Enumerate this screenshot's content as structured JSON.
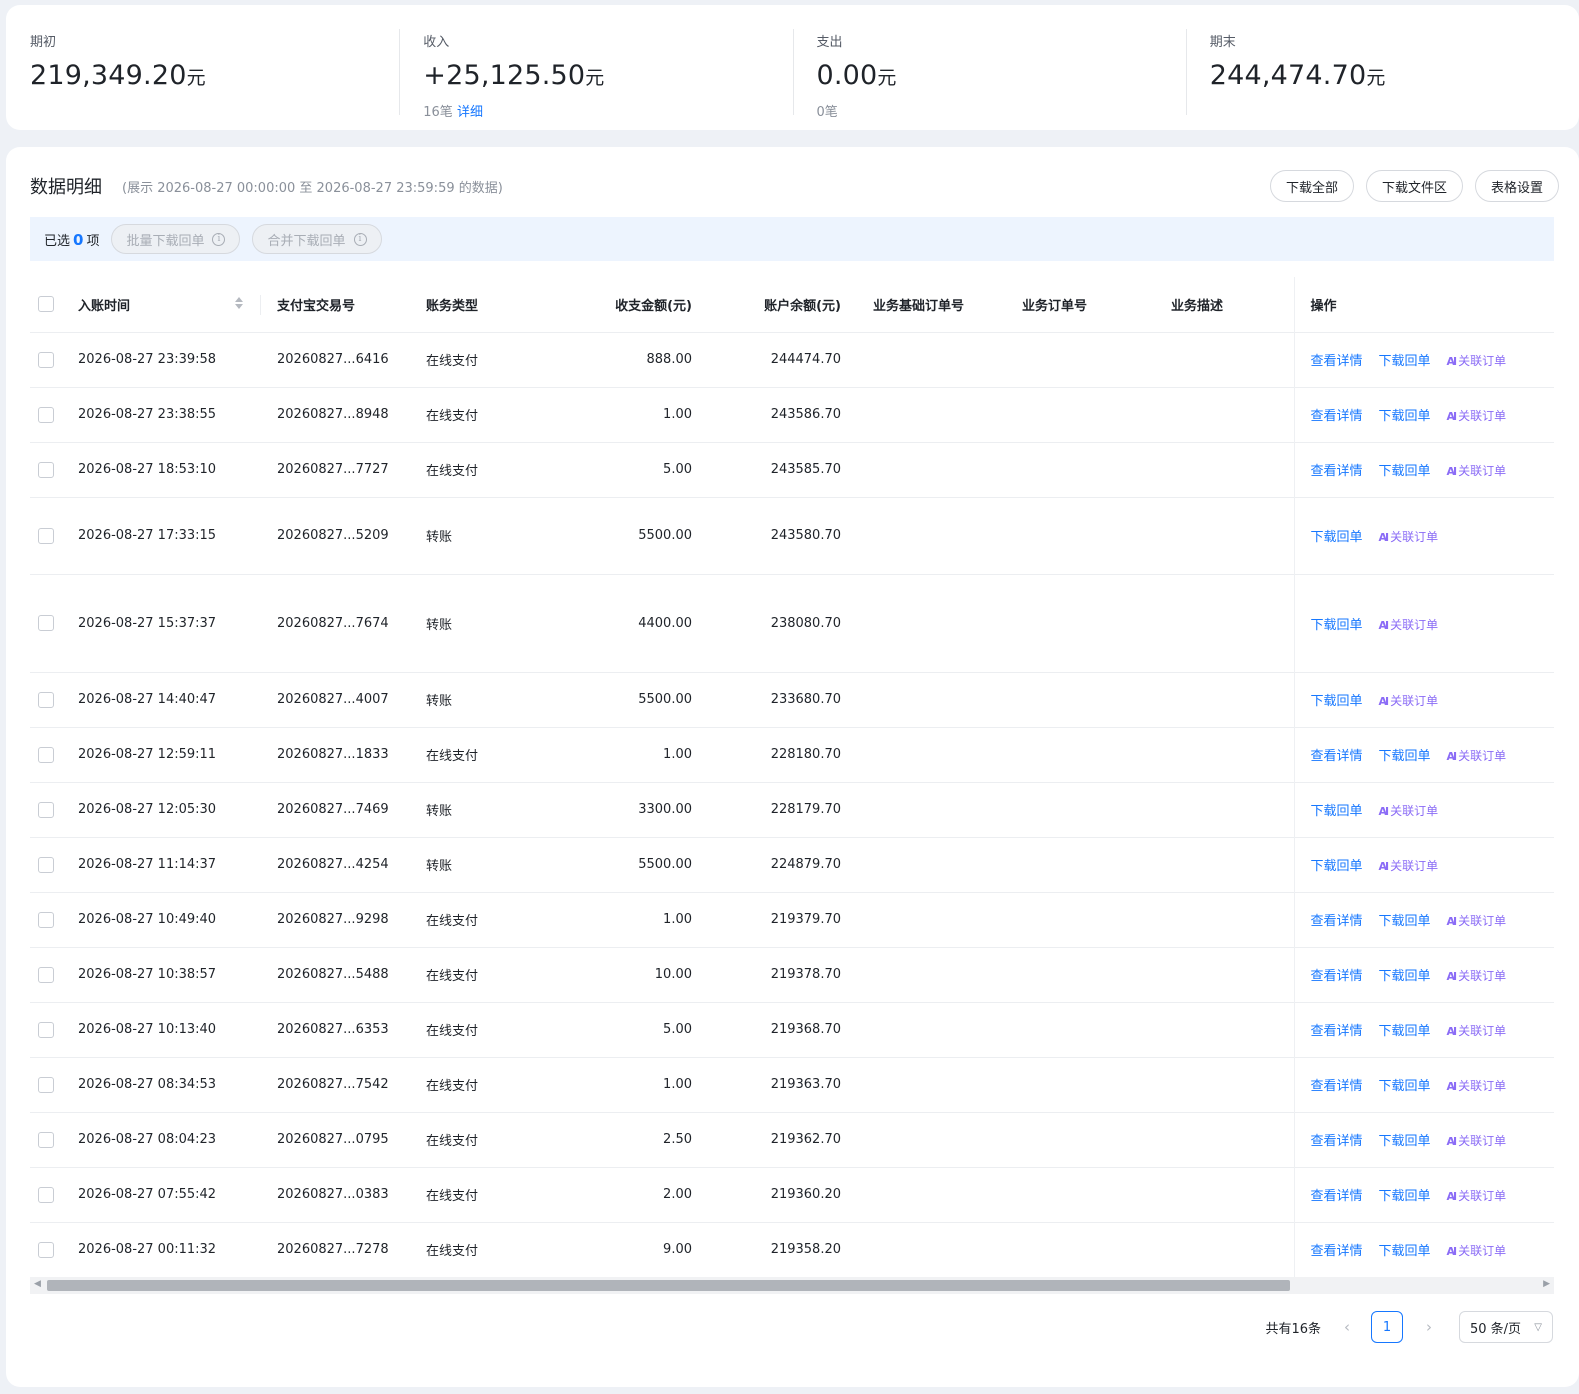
{
  "summary": [
    {
      "label": "期初",
      "value": "219,349.20",
      "unit": "元",
      "sub": "",
      "detail": ""
    },
    {
      "label": "收入",
      "value": "+25,125.50",
      "unit": "元",
      "sub": "16笔",
      "detail": "详细"
    },
    {
      "label": "支出",
      "value": "0.00",
      "unit": "元",
      "sub": "0笔",
      "detail": ""
    },
    {
      "label": "期末",
      "value": "244,474.70",
      "unit": "元",
      "sub": "",
      "detail": ""
    }
  ],
  "section": {
    "title": "数据明细",
    "note": "(展示 2026-08-27 00:00:00 至 2026-08-27 23:59:59 的数据)",
    "buttons": {
      "download_all": "下载全部",
      "download_area": "下载文件区",
      "table_settings": "表格设置"
    }
  },
  "selection": {
    "prefix": "已选",
    "count": "0",
    "suffix": "项",
    "batch_download": "批量下载回单",
    "merge_download": "合并下载回单",
    "info_glyph": "i"
  },
  "table": {
    "columns": {
      "time": "入账时间",
      "trade_no": "支付宝交易号",
      "type": "账务类型",
      "amount": "收支金额(元)",
      "balance": "账户余额(元)",
      "base_order": "业务基础订单号",
      "order": "业务订单号",
      "desc": "业务描述",
      "ops": "操作"
    },
    "actions": {
      "detail": "查看详情",
      "receipt": "下载回单",
      "link_order": "关联订单",
      "ai_glyph": "AI"
    },
    "rows": [
      {
        "time": "2026-08-27 23:39:58",
        "trade_no": "20260827...6416",
        "type": "在线支付",
        "amount": "888.00",
        "balance": "244474.70",
        "has_detail": true
      },
      {
        "time": "2026-08-27 23:38:55",
        "trade_no": "20260827...8948",
        "type": "在线支付",
        "amount": "1.00",
        "balance": "243586.70",
        "has_detail": true
      },
      {
        "time": "2026-08-27 18:53:10",
        "trade_no": "20260827...7727",
        "type": "在线支付",
        "amount": "5.00",
        "balance": "243585.70",
        "has_detail": true
      },
      {
        "time": "2026-08-27 17:33:15",
        "trade_no": "20260827...5209",
        "type": "转账",
        "amount": "5500.00",
        "balance": "243580.70",
        "has_detail": false
      },
      {
        "time": "2026-08-27 15:37:37",
        "trade_no": "20260827...7674",
        "type": "转账",
        "amount": "4400.00",
        "balance": "238080.70",
        "has_detail": false
      },
      {
        "time": "2026-08-27 14:40:47",
        "trade_no": "20260827...4007",
        "type": "转账",
        "amount": "5500.00",
        "balance": "233680.70",
        "has_detail": false
      },
      {
        "time": "2026-08-27 12:59:11",
        "trade_no": "20260827...1833",
        "type": "在线支付",
        "amount": "1.00",
        "balance": "228180.70",
        "has_detail": true
      },
      {
        "time": "2026-08-27 12:05:30",
        "trade_no": "20260827...7469",
        "type": "转账",
        "amount": "3300.00",
        "balance": "228179.70",
        "has_detail": false
      },
      {
        "time": "2026-08-27 11:14:37",
        "trade_no": "20260827...4254",
        "type": "转账",
        "amount": "5500.00",
        "balance": "224879.70",
        "has_detail": false
      },
      {
        "time": "2026-08-27 10:49:40",
        "trade_no": "20260827...9298",
        "type": "在线支付",
        "amount": "1.00",
        "balance": "219379.70",
        "has_detail": true
      },
      {
        "time": "2026-08-27 10:38:57",
        "trade_no": "20260827...5488",
        "type": "在线支付",
        "amount": "10.00",
        "balance": "219378.70",
        "has_detail": true
      },
      {
        "time": "2026-08-27 10:13:40",
        "trade_no": "20260827...6353",
        "type": "在线支付",
        "amount": "5.00",
        "balance": "219368.70",
        "has_detail": true
      },
      {
        "time": "2026-08-27 08:34:53",
        "trade_no": "20260827...7542",
        "type": "在线支付",
        "amount": "1.00",
        "balance": "219363.70",
        "has_detail": true
      },
      {
        "time": "2026-08-27 08:04:23",
        "trade_no": "20260827...0795",
        "type": "在线支付",
        "amount": "2.50",
        "balance": "219362.70",
        "has_detail": true
      },
      {
        "time": "2026-08-27 07:55:42",
        "trade_no": "20260827...0383",
        "type": "在线支付",
        "amount": "2.00",
        "balance": "219360.20",
        "has_detail": true
      },
      {
        "time": "2026-08-27 00:11:32",
        "trade_no": "20260827...7278",
        "type": "在线支付",
        "amount": "9.00",
        "balance": "219358.20",
        "has_detail": true
      }
    ]
  },
  "pagination": {
    "total": "共有16条",
    "current_page": "1",
    "page_size": "50 条/页",
    "prev_glyph": "‹",
    "next_glyph": "›"
  },
  "colors": {
    "accent": "#1677ff",
    "ai_link": "#8b6cf6",
    "selection_bar": "#edf4fe"
  }
}
